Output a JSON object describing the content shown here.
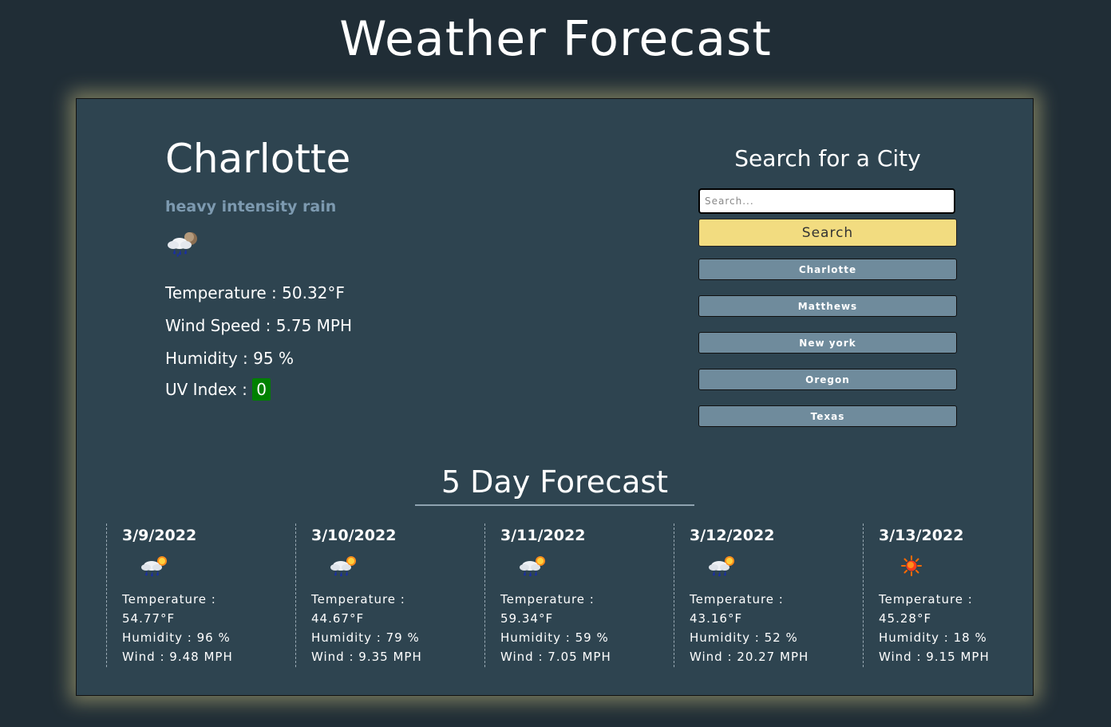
{
  "header": {
    "title": "Weather Forecast"
  },
  "current": {
    "city": "Charlotte",
    "description": "heavy intensity rain",
    "icon": "rain-cloud-icon",
    "temperature": "Temperature : 50.32°F",
    "wind": "Wind Speed : 5.75 MPH",
    "humidity": "Humidity : 95 %",
    "uv_label": "UV Index :",
    "uv_value": "0",
    "uv_color": "#008000"
  },
  "search": {
    "title": "Search for a City",
    "placeholder": "Search...",
    "button_label": "Search",
    "history": [
      "Charlotte",
      "Matthews",
      "New york",
      "Oregon",
      "Texas"
    ]
  },
  "forecast": {
    "title": "5 Day Forecast",
    "days": [
      {
        "date": "3/9/2022",
        "icon": "rain-sun-icon",
        "temp_label": "Temperature :",
        "temp": "54.77°F",
        "humidity": "Humidity : 96 %",
        "wind": "Wind : 9.48 MPH"
      },
      {
        "date": "3/10/2022",
        "icon": "rain-sun-icon",
        "temp_label": "Temperature :",
        "temp": "44.67°F",
        "humidity": "Humidity : 79 %",
        "wind": "Wind : 9.35 MPH"
      },
      {
        "date": "3/11/2022",
        "icon": "rain-sun-icon",
        "temp_label": "Temperature :",
        "temp": "59.34°F",
        "humidity": "Humidity : 59 %",
        "wind": "Wind : 7.05 MPH"
      },
      {
        "date": "3/12/2022",
        "icon": "rain-sun-icon",
        "temp_label": "Temperature :",
        "temp": "43.16°F",
        "humidity": "Humidity : 52 %",
        "wind": "Wind : 20.27 MPH"
      },
      {
        "date": "3/13/2022",
        "icon": "sun-icon",
        "temp_label": "Temperature :",
        "temp": "45.28°F",
        "humidity": "Humidity : 18 %",
        "wind": "Wind : 9.15 MPH"
      }
    ]
  },
  "colors": {
    "background": "#202d36",
    "panel": "#2e4450",
    "accent": "#f2dc80",
    "history_button": "#6f8b9c",
    "description": "#7d9ab0"
  }
}
